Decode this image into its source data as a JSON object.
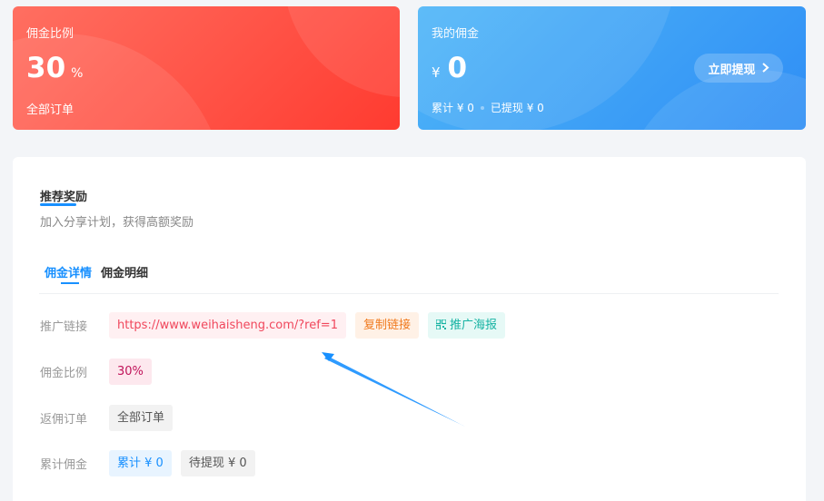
{
  "rate_card": {
    "title": "佣金比例",
    "value": "30",
    "unit": "%",
    "subtitle": "全部订单"
  },
  "commission_card": {
    "title": "我的佣金",
    "currency": "¥",
    "value": "0",
    "total_text": "累计 ¥ 0",
    "withdrawn_text": "已提现 ¥ 0",
    "withdraw_label": "立即提现",
    "withdraw_icon": "chevron-right-icon"
  },
  "reward": {
    "title": "推荐奖励",
    "description": "加入分享计划，获得高额奖励",
    "tabs": [
      {
        "label": "佣金详情",
        "active": true
      },
      {
        "label": "佣金明细",
        "active": false
      }
    ],
    "rows": {
      "link": {
        "label": "推广链接",
        "url": "https://www.weihaisheng.com/?ref=1",
        "copy_label": "复制链接",
        "poster_label": "推广海报",
        "poster_icon": "qrcode-icon"
      },
      "rate": {
        "label": "佣金比例",
        "value": "30%"
      },
      "orders": {
        "label": "返佣订单",
        "value": "全部订单"
      },
      "total": {
        "label": "累计佣金",
        "total": "累计 ¥ 0",
        "pending": "待提现 ¥ 0"
      }
    }
  },
  "colors": {
    "accent": "#1890ff",
    "red_card": "#ff4b3e",
    "blue_card": "#3a9df7"
  }
}
